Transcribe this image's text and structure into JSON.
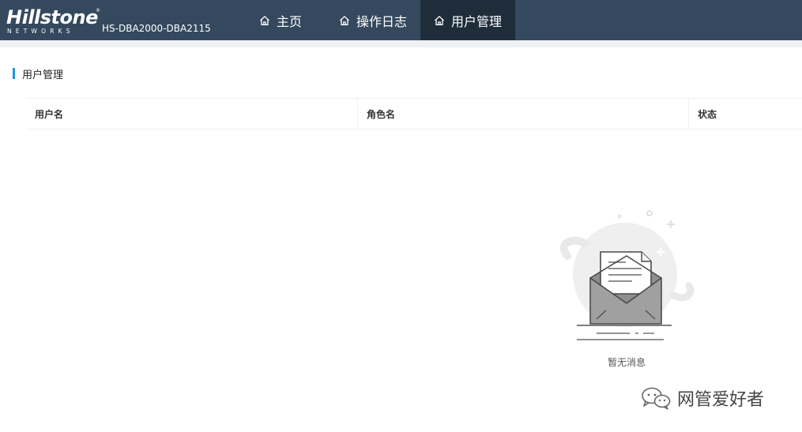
{
  "header": {
    "logo": {
      "brand": "Hillstone",
      "sub": "NETWORKS",
      "reg": "®"
    },
    "device": "HS-DBA2000-DBA2115",
    "nav": [
      {
        "label": "主页",
        "icon": "home-icon",
        "active": false
      },
      {
        "label": "操作日志",
        "icon": "home-icon",
        "active": false
      },
      {
        "label": "用户管理",
        "icon": "home-icon",
        "active": true
      }
    ]
  },
  "main": {
    "section_title": "用户管理",
    "table": {
      "columns": [
        "用户名",
        "角色名",
        "状态"
      ],
      "rows": []
    },
    "empty": {
      "text": "暂无消息",
      "icon": "envelope-icon"
    }
  },
  "watermark": {
    "text": "网管爱好者",
    "icon": "wechat-icon"
  },
  "colors": {
    "header_bg": "#34495e",
    "nav_active_bg": "#1f2d3b",
    "accent": "#1a9bd7",
    "subbar": "#eef2f5"
  }
}
